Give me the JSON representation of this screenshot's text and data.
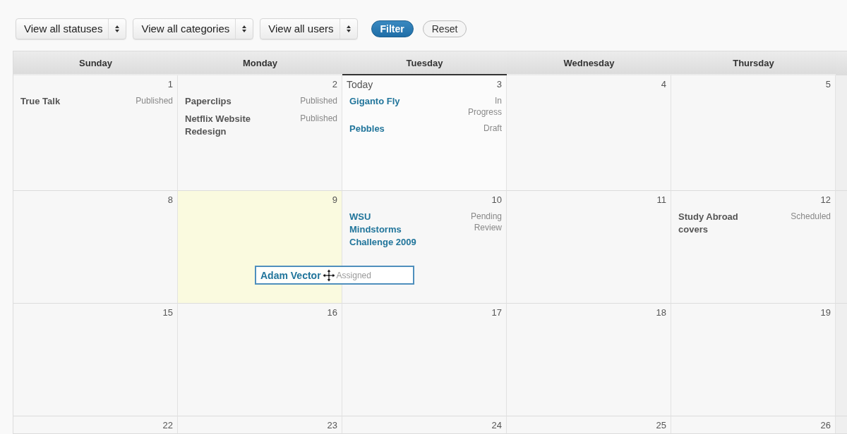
{
  "filters": [
    {
      "label": "View all statuses"
    },
    {
      "label": "View all categories"
    },
    {
      "label": "View all users"
    }
  ],
  "buttons": [
    {
      "label": "Filter",
      "kind": "primary"
    },
    {
      "label": "Reset",
      "kind": "secondary"
    }
  ],
  "weekdays": [
    {
      "label": "Sunday",
      "selected": false
    },
    {
      "label": "Monday",
      "selected": false
    },
    {
      "label": "Tuesday",
      "selected": true
    },
    {
      "label": "Wednesday",
      "selected": false
    },
    {
      "label": "Thursday",
      "selected": false
    }
  ],
  "weeks": [
    {
      "days": [
        {
          "number": "1",
          "highlighted": false,
          "items": [
            {
              "title": "True Talk",
              "status": "Published",
              "editable": false
            }
          ]
        },
        {
          "number": "2",
          "highlighted": false,
          "items": [
            {
              "title": "Paperclips",
              "status": "Published",
              "editable": false
            },
            {
              "title": "Netflix Website Redesign",
              "status": "Published",
              "editable": false
            }
          ]
        },
        {
          "number": "3",
          "today_label": "Today",
          "highlighted": false,
          "items": [
            {
              "title": "Giganto Fly",
              "status": "In Progress",
              "editable": true
            },
            {
              "title": "Pebbles",
              "status": "Draft",
              "editable": true
            }
          ]
        },
        {
          "number": "4",
          "highlighted": false
        },
        {
          "number": "5",
          "highlighted": false
        }
      ]
    },
    {
      "days": [
        {
          "number": "8",
          "highlighted": false
        },
        {
          "number": "9",
          "highlighted": true,
          "dragging": {
            "title": "Adam Vector",
            "status": "Assigned"
          }
        },
        {
          "number": "10",
          "highlighted": false,
          "items": [
            {
              "title": "WSU Mindstorms Challenge 2009",
              "status": "Pending Review",
              "editable": true
            }
          ]
        },
        {
          "number": "11",
          "highlighted": false
        },
        {
          "number": "12",
          "highlighted": false,
          "items": [
            {
              "title": "Study Abroad covers",
              "status": "Scheduled",
              "editable": false
            }
          ]
        }
      ]
    },
    {
      "days": [
        {
          "number": "15",
          "highlighted": false
        },
        {
          "number": "16",
          "highlighted": false
        },
        {
          "number": "17",
          "highlighted": false
        },
        {
          "number": "18",
          "highlighted": false
        },
        {
          "number": "19",
          "highlighted": false
        }
      ]
    },
    {
      "days": [
        {
          "number": "22",
          "highlighted": false
        },
        {
          "number": "23",
          "highlighted": false
        },
        {
          "number": "24",
          "highlighted": false
        },
        {
          "number": "25",
          "highlighted": false
        },
        {
          "number": "26",
          "highlighted": false
        }
      ]
    }
  ]
}
